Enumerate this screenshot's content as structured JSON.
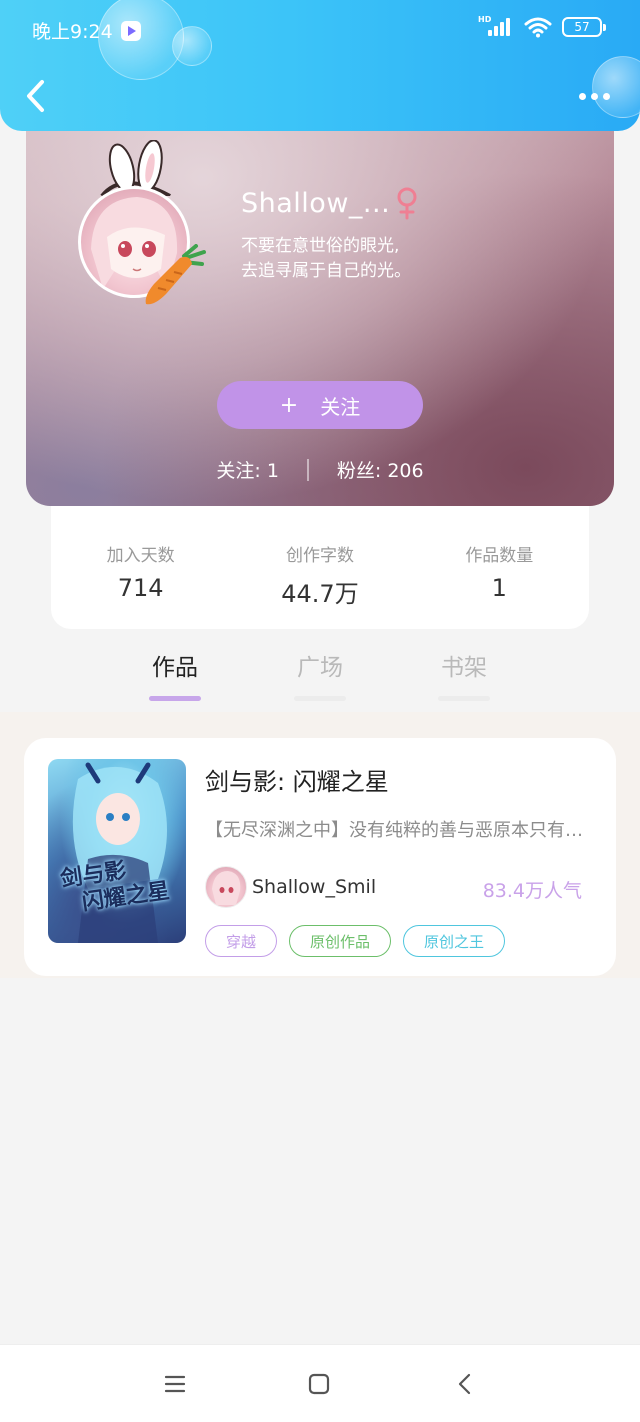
{
  "status_bar": {
    "time": "晚上9:24",
    "network": "HD",
    "battery": "57"
  },
  "header": {
    "back_icon": "chevron-left-icon",
    "more_icon": "more-dots-icon",
    "accent_color": "#3cc4f8"
  },
  "profile": {
    "nickname": "Shallow_...",
    "gender_icon": "female-icon",
    "bio_line1": "不要在意世俗的眼光,",
    "bio_line2": "去追寻属于自己的光。",
    "follow_button": "关注",
    "following_label": "关注: 1",
    "fans_label": "粉丝: 206"
  },
  "stats": [
    {
      "label": "加入天数",
      "value": "714"
    },
    {
      "label": "创作字数",
      "value": "44.7万"
    },
    {
      "label": "作品数量",
      "value": "1"
    }
  ],
  "tabs": [
    {
      "label": "作品",
      "active": true
    },
    {
      "label": "广场",
      "active": false
    },
    {
      "label": "书架",
      "active": false
    }
  ],
  "works": [
    {
      "cover_text_line1": "剑与影",
      "cover_text_line2": "闪耀之星",
      "title": "剑与影: 闪耀之星",
      "description": "【无尽深渊之中】没有纯粹的善与恶原本只有一个…",
      "author": "Shallow_Smil",
      "popularity": "83.4万人气",
      "tags": [
        "穿越",
        "原创作品",
        "原创之王"
      ]
    }
  ],
  "navbar": {
    "menu_icon": "menu-icon",
    "home_icon": "home-square-icon",
    "back_icon": "back-triangle-icon"
  }
}
